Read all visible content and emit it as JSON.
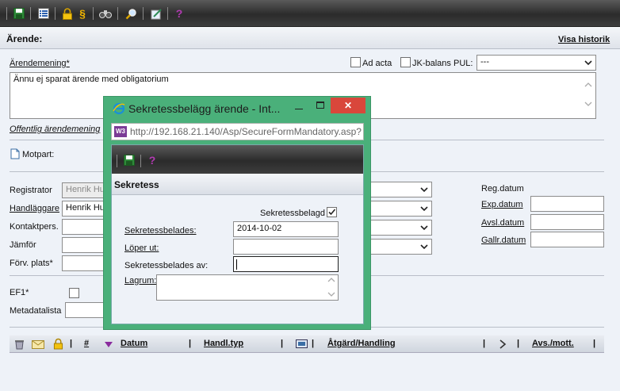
{
  "toolbar": {
    "icons": [
      "save-icon",
      "list-icon",
      "lock-icon",
      "paragraph-icon",
      "binoculars-icon",
      "search-icon",
      "edit-icon",
      "help-icon"
    ],
    "help_glyph": "?",
    "paragraph_glyph": "§"
  },
  "header": {
    "title": "Ärende:",
    "history_link": "Visa historik"
  },
  "form": {
    "arendemening_label": "Ärendemening*",
    "ad_acta_label": "Ad acta",
    "jk_balans_label": "JK-balans",
    "pul_label": "PUL:",
    "pul_value": "---",
    "arendemening_value": "Ännu ej sparat ärende med obligatorium",
    "offentlig_label": "Offentlig ärendemening",
    "motpart_label": "Motpart:",
    "registrator_label": "Registrator",
    "registrator_value": "Henrik Hu",
    "handlaggare_label": "Handläggare",
    "handlaggare_value": "Henrik Hu",
    "kontaktpers_label": "Kontaktpers.",
    "jamfor_label": "Jämför",
    "forv_plats_label": "Förv. plats*",
    "reg_datum_label": "Reg.datum",
    "exp_datum_label": "Exp.datum",
    "avsl_datum_label": "Avsl.datum",
    "gallr_datum_label": "Gallr.datum",
    "ef1_label": "EF1*",
    "metadatalista_label": "Metadatalista"
  },
  "grid": {
    "icons": [
      "trash-icon",
      "envelope-icon",
      "lock-icon"
    ],
    "sep": "|",
    "col_nr": "#",
    "col_datum": "Datum",
    "col_handl_typ": "Handl.typ",
    "col_atgard": "Åtgärd/Handling",
    "col_avs": "Avs./mott."
  },
  "popup": {
    "title": "Sekretessbelägg ärende - Int...",
    "url": "http://192.168.21.140/Asp/SecureFormMandatory.asp?I",
    "section_title": "Sekretess",
    "sekretessbelagd_label": "Sekretessbelagd",
    "sekretessbelagd_checked": true,
    "sekretessbelades_label": "Sekretessbelades:",
    "sekretessbelades_value": "2014-10-02",
    "loper_ut_label": "Löper ut:",
    "loper_ut_value": "",
    "sekretessbelades_av_label": "Sekretessbelades av:",
    "sekretessbelades_av_value": "",
    "lagrum_label": "Lagrum:",
    "lagrum_value": "",
    "help_glyph": "?",
    "close_glyph": "✕"
  },
  "colors": {
    "toolbar_dark": "#2b2b2b",
    "popup_border": "#4ab07a",
    "close_button": "#d9473b",
    "help_purple": "#a52aa5"
  }
}
